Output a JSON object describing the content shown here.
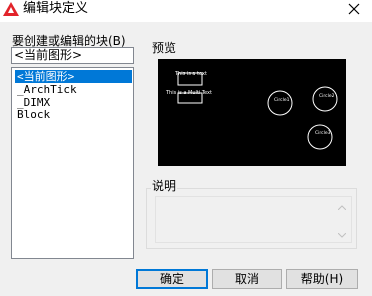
{
  "window": {
    "title": "编辑块定义"
  },
  "left_panel": {
    "label": "要创建或编辑的块(B)",
    "combo_value": "<当前图形>",
    "items": [
      "<当前图形>",
      "_ArchTick",
      "_DIMX",
      "Block"
    ],
    "selected_index": 0
  },
  "preview": {
    "label": "预览",
    "texts": [
      "This is a text",
      "This is a Multi Text",
      "Circle1",
      "Circle2",
      "Circle3"
    ]
  },
  "description": {
    "label": "说明",
    "value": ""
  },
  "buttons": {
    "ok": "确定",
    "cancel": "取消",
    "help": "帮助(H)"
  },
  "colors": {
    "accent": "#0078d7",
    "preview_bg": "#000000",
    "app_icon": "#e2232a"
  }
}
